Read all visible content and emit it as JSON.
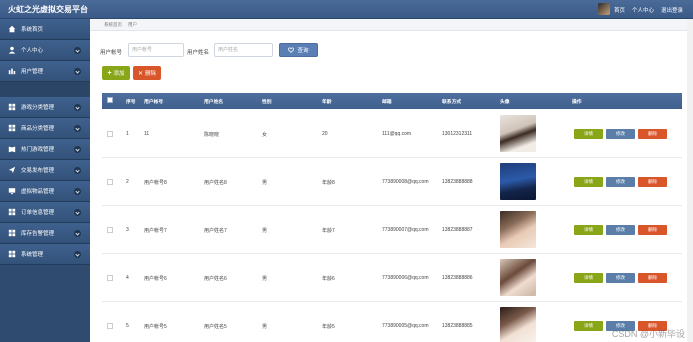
{
  "app": {
    "title": "火虹之光虚拟交易平台",
    "top_links": [
      "首页",
      "个人中心",
      "退出登录"
    ]
  },
  "sidebar": {
    "items": [
      {
        "label": "系统首页",
        "icon": "home-icon"
      },
      {
        "label": "个人中心",
        "icon": "user-icon"
      },
      {
        "label": "用户管理",
        "icon": "bar-chart-icon"
      },
      {
        "label": "游戏分类管理",
        "icon": "grid-icon"
      },
      {
        "label": "商品分类管理",
        "icon": "grid-icon"
      },
      {
        "label": "热门游戏管理",
        "icon": "book-icon"
      },
      {
        "label": "交易发布管理",
        "icon": "send-icon"
      },
      {
        "label": "虚拟物品管理",
        "icon": "monitor-icon"
      },
      {
        "label": "订单信息管理",
        "icon": "grid-icon"
      },
      {
        "label": "库存告警管理",
        "icon": "grid-icon"
      },
      {
        "label": "系统管理",
        "icon": "grid-icon"
      }
    ],
    "submenu_label": "用户"
  },
  "breadcrumb": [
    "系统首页",
    "用户"
  ],
  "search": {
    "label1": "用户帐号",
    "placeholder1": "用户帐号",
    "label2": "用户姓名",
    "placeholder2": "用户姓名",
    "button": "查询"
  },
  "actions": {
    "add": "添加",
    "delete": "删除"
  },
  "table": {
    "headers": [
      "序号",
      "用户帐号",
      "用户姓名",
      "性别",
      "年龄",
      "邮箱",
      "联系方式",
      "头像",
      "操作"
    ],
    "row_buttons": {
      "view": "详情",
      "edit": "修改",
      "delete": "删除"
    },
    "rows": [
      {
        "index": "1",
        "account": "11",
        "name": "陈晓晓",
        "gender": "女",
        "age": "20",
        "email": "111@qq.com",
        "phone": "13012312311"
      },
      {
        "index": "2",
        "account": "用户帐号8",
        "name": "用户姓名8",
        "gender": "男",
        "age": "年龄8",
        "email": "773890008@qq.com",
        "phone": "13823888888"
      },
      {
        "index": "3",
        "account": "用户帐号7",
        "name": "用户姓名7",
        "gender": "男",
        "age": "年龄7",
        "email": "773890007@qq.com",
        "phone": "13823888887"
      },
      {
        "index": "4",
        "account": "用户帐号6",
        "name": "用户姓名6",
        "gender": "男",
        "age": "年龄6",
        "email": "773890006@qq.com",
        "phone": "13823888886"
      },
      {
        "index": "5",
        "account": "用户帐号5",
        "name": "用户姓名5",
        "gender": "男",
        "age": "年龄5",
        "email": "773890005@qq.com",
        "phone": "13823888885"
      }
    ]
  },
  "watermark": "CSDN @小新毕设",
  "colors": {
    "header": "#3f5f8c",
    "sidebar": "#33527a",
    "green": "#88a618",
    "red": "#d9562b",
    "blue": "#5a7ea8"
  }
}
